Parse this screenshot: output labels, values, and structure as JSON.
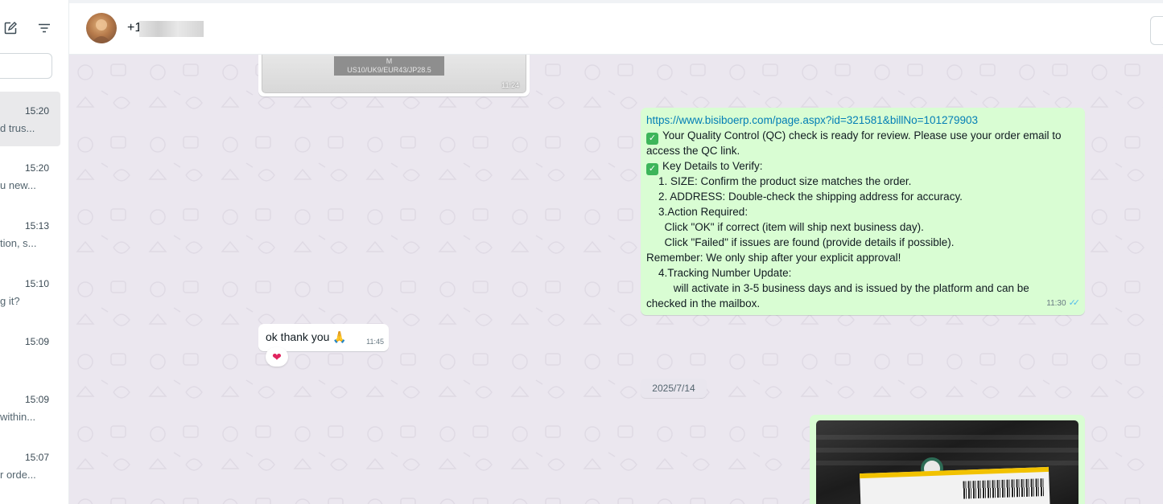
{
  "header": {
    "contact_name": "+1"
  },
  "sidebar": {
    "chats": [
      {
        "time": "15:20",
        "preview": "d trus...",
        "active": true
      },
      {
        "time": "15:20",
        "preview": "u new..."
      },
      {
        "time": "15:13",
        "preview": "tion, s..."
      },
      {
        "time": "15:10",
        "preview": "g it?"
      },
      {
        "time": "15:09",
        "preview": ""
      },
      {
        "time": "15:09",
        "preview": "within..."
      },
      {
        "time": "15:07",
        "preview": "r orde..."
      }
    ]
  },
  "messages": {
    "top_image": {
      "size_label_line1": "M",
      "size_label_line2": "US10/UK9/EUR43/JP28.5",
      "time": "11:24"
    },
    "outgoing_text": {
      "lines": [
        "https://www.bisiboerp.com/page.aspx?id=321581&billNo=101279903",
        "Your Quality Control (QC) check is ready for review. Please use your order email to",
        "access the QC link.",
        "Key Details to Verify:",
        "    1. SIZE: Confirm the product size matches the order.",
        "    2. ADDRESS: Double-check the shipping address for accuracy.",
        "    3.Action Required:",
        "      Click \"OK\" if correct (item will ship next business day).",
        "      Click \"Failed\" if issues are found (provide details if possible).",
        "Remember: We only ship after your explicit approval!",
        "    4.Tracking Number Update:",
        "         will activate in 3-5 business days and is issued by the platform and can be",
        "checked in the mailbox."
      ],
      "time": "11:30"
    },
    "incoming_text": {
      "text": "ok thank you 🙏",
      "time": "11:45",
      "reaction": "❤"
    },
    "date_chip": "2025/7/14"
  },
  "colors": {
    "outgoing_bubble": "#d9fdd3",
    "incoming_bubble": "#ffffff",
    "chat_background": "#ebe7ef",
    "link": "#027eb5",
    "read_ticks": "#53bdeb"
  }
}
